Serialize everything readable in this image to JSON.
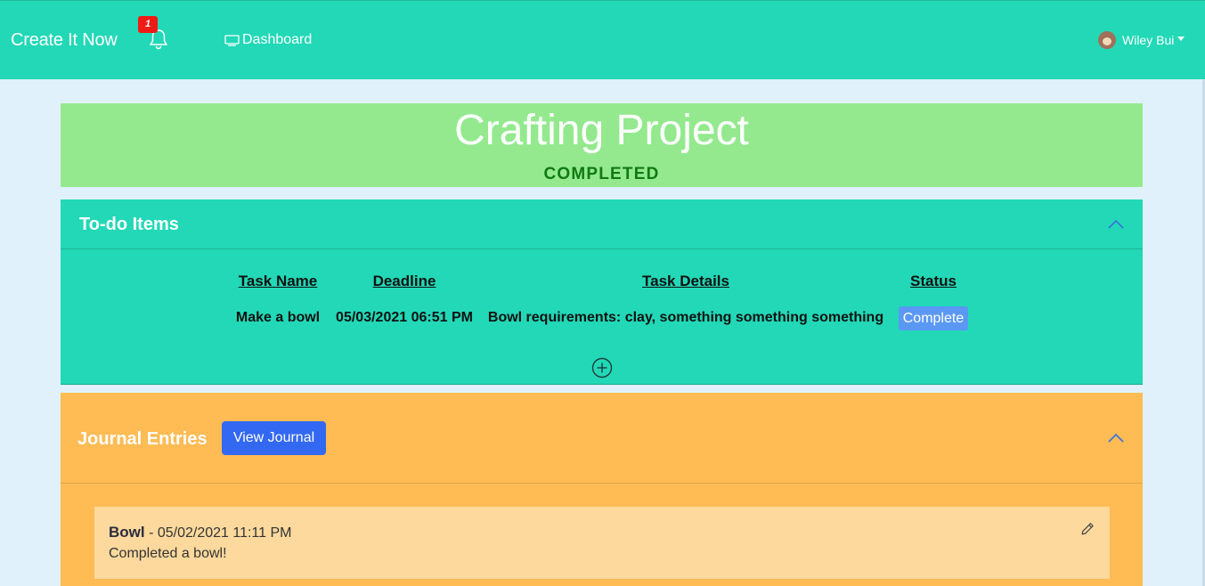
{
  "navbar": {
    "brand": "Create It Now",
    "notification_count": "1",
    "dashboard_label": "Dashboard",
    "user_name": "Wiley Bui"
  },
  "project": {
    "title": "Crafting Project",
    "status": "COMPLETED"
  },
  "todo": {
    "heading": "To-do Items",
    "columns": [
      "Task Name",
      "Deadline",
      "Task Details",
      "Status"
    ],
    "rows": [
      {
        "name": "Make a bowl",
        "deadline": "05/03/2021 06:51 PM",
        "details": "Bowl requirements: clay, something something something",
        "status": "Complete"
      }
    ]
  },
  "journal": {
    "heading": "Journal Entries",
    "view_button": "View Journal",
    "entries": [
      {
        "title": "Bowl",
        "timestamp": "- 05/02/2021 11:11 PM",
        "body": "Completed a bowl!"
      }
    ]
  },
  "colors": {
    "navbar": "#22d8b7",
    "background": "#e0f1fb",
    "title_band": "#94e98f",
    "journal": "#ffbb54",
    "entry": "#fdd99d",
    "primary_button": "#3368f3",
    "status_button": "#5a98f4",
    "notification_badge": "#f01b16"
  },
  "icons": [
    "bell-icon",
    "monitor-icon",
    "chevron-up-icon",
    "plus-circle-icon",
    "pencil-icon",
    "avatar"
  ]
}
